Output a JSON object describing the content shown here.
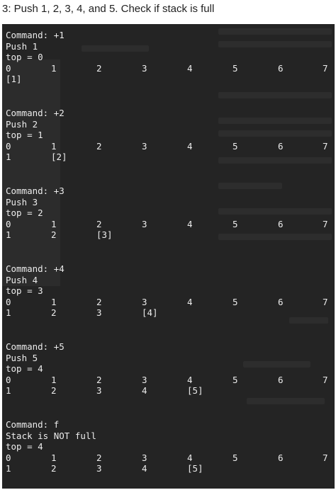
{
  "heading": "3: Push 1, 2, 3, 4, and 5. Check if stack is full",
  "console": {
    "index_row": [
      "0",
      "1",
      "2",
      "3",
      "4",
      "5",
      "6",
      "7"
    ],
    "blocks": [
      {
        "command": "Command: +1",
        "message": "Push 1",
        "top": "top = 0",
        "values": [
          "[1]"
        ]
      },
      {
        "command": "Command: +2",
        "message": "Push 2",
        "top": "top = 1",
        "values": [
          "1",
          "[2]"
        ]
      },
      {
        "command": "Command: +3",
        "message": "Push 3",
        "top": "top = 2",
        "values": [
          "1",
          "2",
          "[3]"
        ]
      },
      {
        "command": "Command: +4",
        "message": "Push 4",
        "top": "top = 3",
        "values": [
          "1",
          "2",
          "3",
          "[4]"
        ]
      },
      {
        "command": "Command: +5",
        "message": "Push 5",
        "top": "top = 4",
        "values": [
          "1",
          "2",
          "3",
          "4",
          "[5]"
        ]
      },
      {
        "command": "Command: f",
        "message": "Stack is NOT full",
        "top": "top = 4",
        "values": [
          "1",
          "2",
          "3",
          "4",
          "[5]"
        ]
      }
    ]
  }
}
